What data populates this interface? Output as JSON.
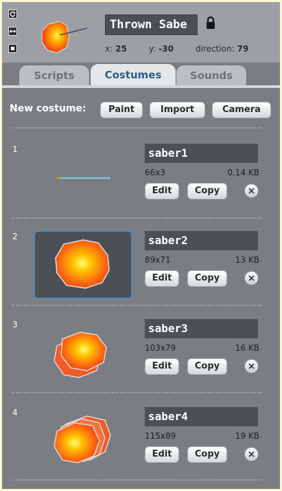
{
  "sprite": {
    "name": "Thrown Sabe",
    "x_label": "x:",
    "x": "25",
    "y_label": "y:",
    "y": "-30",
    "direction_label": "direction:",
    "direction": "79"
  },
  "tabs": [
    {
      "label": "Scripts",
      "active": false
    },
    {
      "label": "Costumes",
      "active": true
    },
    {
      "label": "Sounds",
      "active": false
    }
  ],
  "new_costume": {
    "label": "New costume:",
    "paint": "Paint",
    "import": "Import",
    "camera": "Camera"
  },
  "costumes": [
    {
      "number": "1",
      "name": "saber1",
      "dims": "66x3",
      "size": "0.14 KB",
      "edit": "Edit",
      "copy": "Copy",
      "selected": false
    },
    {
      "number": "2",
      "name": "saber2",
      "dims": "89x71",
      "size": "13 KB",
      "edit": "Edit",
      "copy": "Copy",
      "selected": true
    },
    {
      "number": "3",
      "name": "saber3",
      "dims": "103x79",
      "size": "16 KB",
      "edit": "Edit",
      "copy": "Copy",
      "selected": false
    },
    {
      "number": "4",
      "name": "saber4",
      "dims": "115x89",
      "size": "19 KB",
      "edit": "Edit",
      "copy": "Copy",
      "selected": false
    }
  ],
  "colors": {
    "background": "#7A7D81",
    "active_tab_text": "#2B5F86",
    "selection_border": "#4C8BC7"
  }
}
